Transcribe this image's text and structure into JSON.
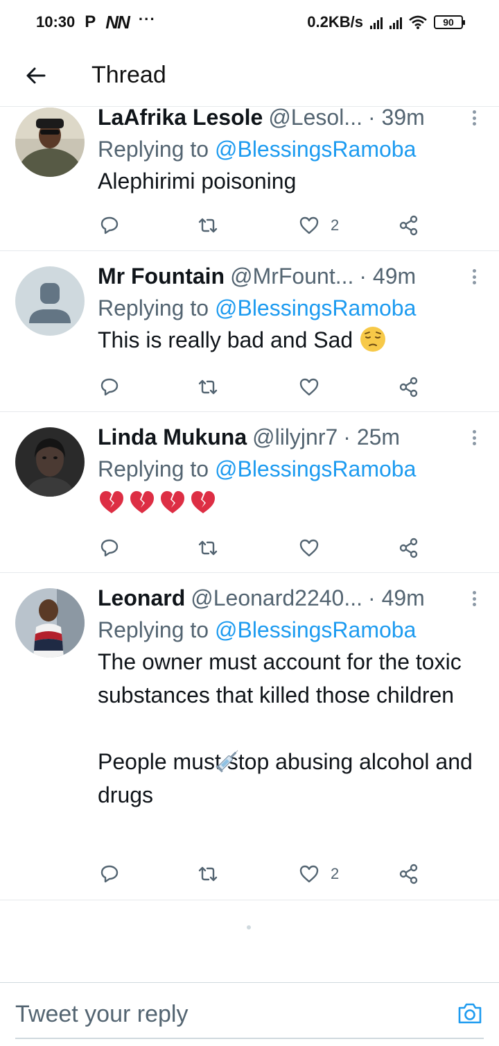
{
  "status_bar": {
    "time": "10:30",
    "carrier_p": "P",
    "carrier_nn": "NN",
    "dots": "···",
    "speed": "0.2KB/s",
    "battery": "90"
  },
  "header": {
    "back_icon": "arrow-left-icon",
    "title": "Thread"
  },
  "tweets": [
    {
      "name": "LaAfrika Lesole",
      "handle": "@Lesol...",
      "time": "· 39m",
      "replying_prefix": "Replying to ",
      "replying_to": "@BlessingsRamoba",
      "text": "Alephirimi poisoning",
      "emoji": "",
      "reply_count": "",
      "retweet_count": "",
      "like_count": "2"
    },
    {
      "name": "Mr Fountain",
      "handle": "@MrFount...",
      "time": "· 49m",
      "replying_prefix": "Replying to ",
      "replying_to": "@BlessingsRamoba",
      "text": "This is really bad and Sad",
      "emoji": "pensive-face",
      "reply_count": "",
      "retweet_count": "",
      "like_count": ""
    },
    {
      "name": "Linda Mukuna",
      "handle": "@lilyjnr7",
      "time": "· 25m",
      "replying_prefix": "Replying to ",
      "replying_to": "@BlessingsRamoba",
      "text": "",
      "emoji": "broken-heart x4",
      "reply_count": "",
      "retweet_count": "",
      "like_count": ""
    },
    {
      "name": "Leonard",
      "handle": "@Leonard2240...",
      "time": "· 49m",
      "replying_prefix": "Replying to ",
      "replying_to": "@BlessingsRamoba",
      "text": "The owner must account for the toxic substances that killed those children\n\nPeople must stop abusing alcohol and drugs",
      "emoji": "syringe",
      "reply_count": "",
      "retweet_count": "",
      "like_count": "2"
    }
  ],
  "reply_bar": {
    "placeholder": "Tweet your reply",
    "camera_icon": "camera-icon"
  },
  "colors": {
    "accent": "#1d9bf0",
    "secondary_text": "#536471",
    "divider": "#e6e9ec"
  }
}
